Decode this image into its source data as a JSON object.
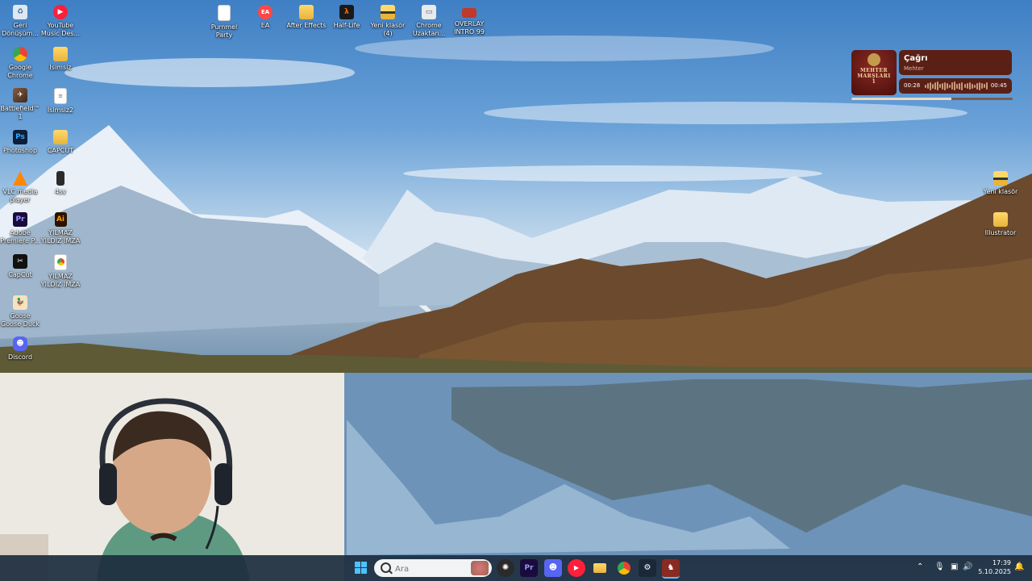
{
  "desktop": {
    "icons_left": [
      {
        "label": "Geri Dönüşüm...",
        "icon": "recycle-bin-icon"
      },
      {
        "label": "YouTube Music Des...",
        "icon": "youtube-music-icon"
      },
      {
        "label": "Google Chrome",
        "icon": "chrome-icon"
      },
      {
        "label": "İsimsiz",
        "icon": "folder-icon"
      },
      {
        "label": "Battlefield™ 1",
        "icon": "battlefield-icon"
      },
      {
        "label": "İsimsiz2",
        "icon": "text-file-icon"
      },
      {
        "label": "Photoshop",
        "icon": "photoshop-icon"
      },
      {
        "label": "CAPCUT",
        "icon": "folder-icon"
      },
      {
        "label": "VLC media player",
        "icon": "vlc-icon"
      },
      {
        "label": "4sv",
        "icon": "file-icon"
      },
      {
        "label": "Adobe Premiere P...",
        "icon": "premiere-icon"
      },
      {
        "label": "YILMAZ YILDIZ İMZA",
        "icon": "illustrator-file-icon"
      },
      {
        "label": "CapCut",
        "icon": "capcut-icon"
      },
      {
        "label": "YILMAZ YILDIZ İMZA",
        "icon": "chrome-file-icon"
      },
      {
        "label": "Goose Goose Duck",
        "icon": "goose-goose-duck-icon"
      },
      {
        "label": "Discord",
        "icon": "discord-icon"
      }
    ],
    "icons_top": [
      {
        "label": "Pummel Party",
        "icon": "text-file-icon"
      },
      {
        "label": "EA",
        "icon": "ea-icon"
      },
      {
        "label": "After Effects",
        "icon": "folder-icon"
      },
      {
        "label": "Half-Life",
        "icon": "half-life-icon"
      },
      {
        "label": "Yeni klasör (4)",
        "icon": "folder-icon"
      },
      {
        "label": "Chrome Uzaktan...",
        "icon": "chrome-remote-icon"
      },
      {
        "label": "OVERLAY INTRO 99",
        "icon": "video-file-icon"
      }
    ],
    "icons_right": [
      {
        "label": "Yeni klasör",
        "icon": "folder-icon"
      },
      {
        "label": "Illustrator",
        "icon": "folder-icon"
      }
    ]
  },
  "music_widget": {
    "album_text": [
      "MEHTER",
      "MARŞLARI",
      "1"
    ],
    "title": "Çağrı",
    "artist": "Mehter",
    "current_time": "00:28",
    "total_time": "00:45",
    "progress": 0.62
  },
  "taskbar": {
    "search_placeholder": "Ara",
    "apps": [
      "windows-start-icon",
      "chatgpt-icon",
      "premiere-icon",
      "discord-icon",
      "youtube-music-icon",
      "file-explorer-icon",
      "chrome-icon",
      "steam-icon",
      "active-app-icon"
    ],
    "tray": [
      "chevron-up-icon",
      "microphone-icon",
      "network-icon",
      "volume-icon"
    ],
    "time": "17:39",
    "date": "5.10.2025",
    "colors": {
      "taskbar": "#1c2c3e",
      "accent": "#4cc2ff"
    }
  }
}
